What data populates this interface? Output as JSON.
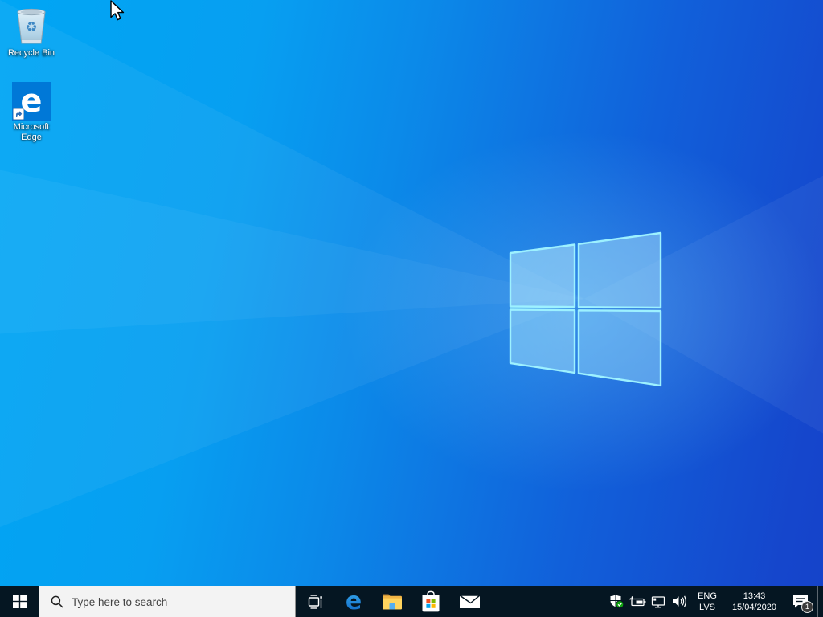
{
  "desktop": {
    "icons": [
      {
        "id": "recycle-bin",
        "label": "Recycle Bin"
      },
      {
        "id": "microsoft-edge",
        "label": "Microsoft Edge",
        "tile_letter": "e"
      }
    ]
  },
  "taskbar": {
    "search": {
      "placeholder": "Type here to search"
    },
    "app_buttons": [
      "task-view",
      "microsoft-edge",
      "file-explorer",
      "microsoft-store",
      "mail"
    ],
    "tray": {
      "icons": [
        "windows-security",
        "battery",
        "network",
        "volume"
      ],
      "language": {
        "primary": "ENG",
        "secondary": "LVS"
      },
      "clock": {
        "time": "13:43",
        "date": "15/04/2020"
      },
      "action_center": {
        "badge": "1"
      }
    }
  },
  "colors": {
    "wallpaper_left": "#00a6f4",
    "wallpaper_right": "#1543ca",
    "taskbar": "#051622",
    "accent_tile": "#0078d7",
    "security_check": "#10a310",
    "store_red": "#f25022",
    "store_green": "#7fba00",
    "store_blue": "#00a4ef",
    "store_yellow": "#ffb900",
    "folder_yellow": "#ffd45e"
  }
}
